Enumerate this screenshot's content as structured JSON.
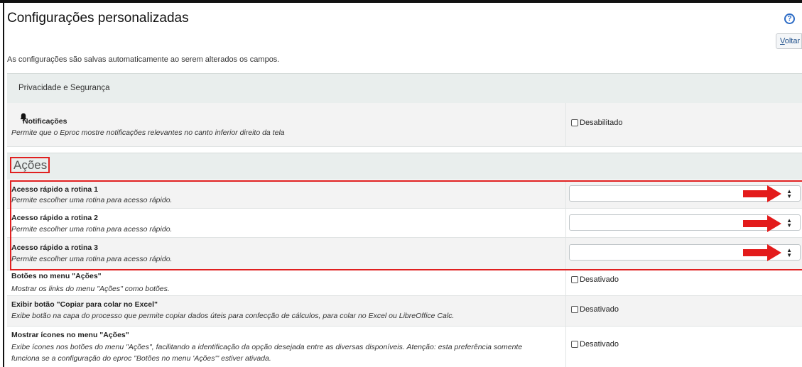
{
  "header": {
    "title": "Configurações personalizadas",
    "help_icon": "help-circle-icon",
    "back_prefix": "V",
    "back_rest": "oltar",
    "info": "As configurações são salvas automaticamente ao serem alterados os campos."
  },
  "privacy_section": {
    "title": "Privacidade e Segurança",
    "notifications": {
      "icon": "bell-icon",
      "label": "Notificações",
      "description": "Permite que o Eproc mostre notificações relevantes no canto inferior direito da tela",
      "checkbox_label": "Desabilitado",
      "checked": false
    }
  },
  "acoes_section": {
    "title": "Ações",
    "quick_access": [
      {
        "label": "Acesso rápido a rotina 1",
        "description": "Permite escolher uma rotina para acesso rápido.",
        "value": ""
      },
      {
        "label": "Acesso rápido a rotina 2",
        "description": "Permite escolher uma rotina para acesso rápido.",
        "value": ""
      },
      {
        "label": "Acesso rápido a rotina 3",
        "description": "Permite escolher uma rotina para acesso rápido.",
        "value": ""
      }
    ],
    "settings": [
      {
        "label": "Botões no menu \"Ações\"",
        "description": "Mostrar os links do menu \"Ações\" como botões.",
        "checkbox_label": "Desativado",
        "checked": false
      },
      {
        "label": "Exibir botão \"Copiar para colar no Excel\"",
        "description": "Exibe botão na capa do processo que permite copiar dados úteis para confecção de cálculos, para colar no Excel ou LibreOffice Calc.",
        "checkbox_label": "Desativado",
        "checked": false
      },
      {
        "label": "Mostrar ícones no menu \"Ações\"",
        "description_line1": "Exibe ícones nos botões do menu \"Ações\", facilitando a identificação da opção desejada entre as diversas disponíveis. Atenção: esta preferência somente",
        "description_line2": "funciona se a configuração do eproc \"Botões no menu 'Ações'\" estiver ativada.",
        "checkbox_label": "Desativado",
        "checked": false
      }
    ]
  },
  "colors": {
    "highlight": "#e02020",
    "section_bg": "#e9eeed",
    "link": "#1f4f8a",
    "help": "#2a6ac5"
  }
}
